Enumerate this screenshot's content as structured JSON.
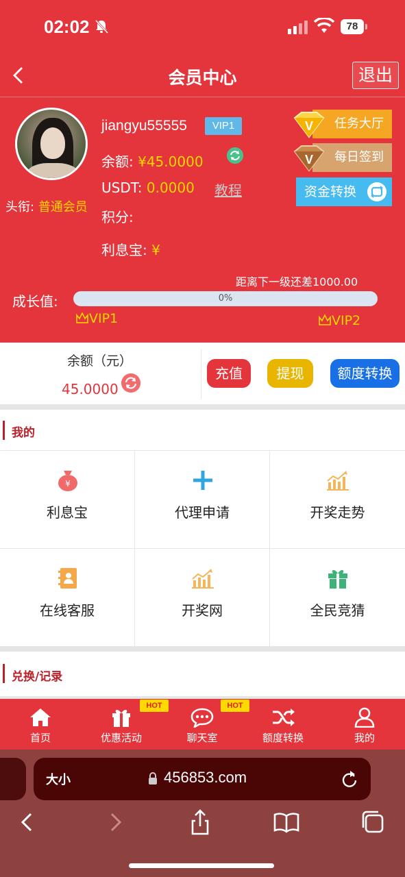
{
  "status_bar": {
    "time": "02:02",
    "battery": "78"
  },
  "header": {
    "title": "会员中心",
    "logout_label": "退出"
  },
  "profile": {
    "username": "jiangyu55555",
    "vip_level": "VIP1",
    "title_label": "头衔:",
    "title_value": "普通会员",
    "balance_label": "余额:",
    "balance_value": "¥45.0000",
    "usdt_label": "USDT:",
    "usdt_value": "0.0000",
    "tutorial_link": "教程",
    "points_label": "积分:",
    "interest_label": "利息宝:",
    "interest_value": "¥",
    "task_hall_label": "任务大厅",
    "daily_signin_label": "每日签到",
    "fund_transfer_label": "资金转换",
    "growth_label": "成长值:",
    "next_level_gap": "距离下一级还差1000.00",
    "progress_text": "0%",
    "progress_fraction": 0,
    "current_level": "VIP1",
    "next_level": "VIP2"
  },
  "balance_bar": {
    "label": "余额（元）",
    "amount": "45.0000",
    "recharge_label": "充值",
    "withdraw_label": "提现",
    "quota_transfer_label": "额度转换"
  },
  "mine_section": {
    "heading": "我的",
    "items": [
      {
        "label": "利息宝",
        "icon": "money-bag-icon"
      },
      {
        "label": "代理申请",
        "icon": "plus-icon"
      },
      {
        "label": "开奖走势",
        "icon": "trend-chart-icon"
      },
      {
        "label": "在线客服",
        "icon": "contact-book-icon"
      },
      {
        "label": "开奖网",
        "icon": "trend-chart-icon"
      },
      {
        "label": "全民竞猜",
        "icon": "gift-icon"
      }
    ]
  },
  "exchange_section": {
    "heading": "兑换/记录"
  },
  "tab_bar": {
    "items": [
      {
        "label": "首页",
        "icon": "home-icon"
      },
      {
        "label": "优惠活动",
        "icon": "gift-icon",
        "badge": "HOT"
      },
      {
        "label": "聊天室",
        "icon": "chat-icon",
        "badge": "HOT"
      },
      {
        "label": "额度转换",
        "icon": "shuffle-icon"
      },
      {
        "label": "我的",
        "icon": "user-icon"
      }
    ]
  },
  "browser": {
    "text_size_label": "大小",
    "url": "456853.com"
  },
  "colors": {
    "primary_red": "#e3353b",
    "gold": "#ffd700",
    "withdraw_yellow": "#e8b500",
    "quota_blue": "#1970e6",
    "section_red": "#b8222a"
  }
}
